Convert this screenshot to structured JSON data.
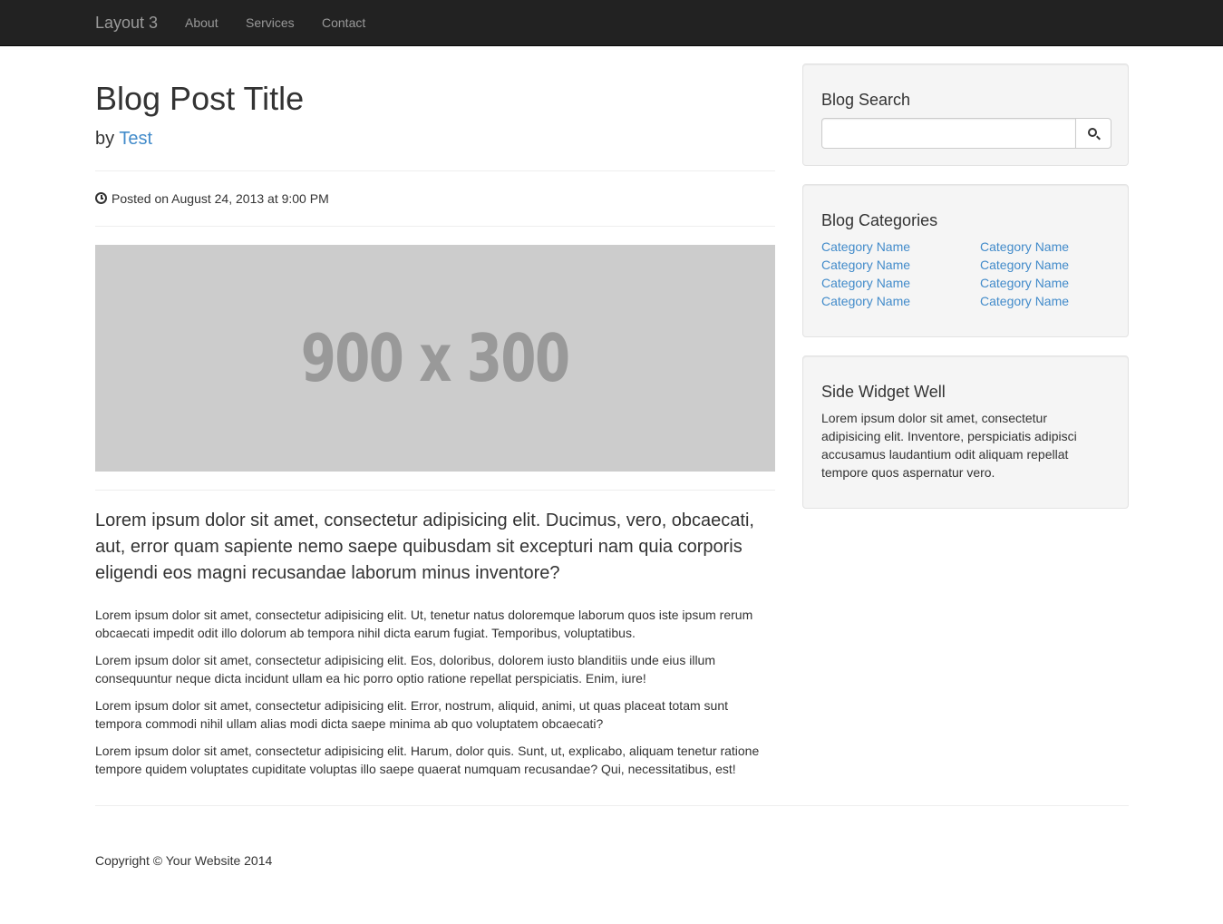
{
  "navbar": {
    "brand": "Layout 3",
    "links": [
      "About",
      "Services",
      "Contact"
    ]
  },
  "post": {
    "title": "Blog Post Title",
    "by_prefix": "by",
    "author": "Test",
    "posted_on": "Posted on August 24, 2013 at 9:00 PM",
    "image_placeholder": "900 x 300",
    "lead": "Lorem ipsum dolor sit amet, consectetur adipisicing elit. Ducimus, vero, obcaecati, aut, error quam sapiente nemo saepe quibusdam sit excepturi nam quia corporis eligendi eos magni recusandae laborum minus inventore?",
    "paragraphs": [
      "Lorem ipsum dolor sit amet, consectetur adipisicing elit. Ut, tenetur natus doloremque laborum quos iste ipsum rerum obcaecati impedit odit illo dolorum ab tempora nihil dicta earum fugiat. Temporibus, voluptatibus.",
      "Lorem ipsum dolor sit amet, consectetur adipisicing elit. Eos, doloribus, dolorem iusto blanditiis unde eius illum consequuntur neque dicta incidunt ullam ea hic porro optio ratione repellat perspiciatis. Enim, iure!",
      "Lorem ipsum dolor sit amet, consectetur adipisicing elit. Error, nostrum, aliquid, animi, ut quas placeat totam sunt tempora commodi nihil ullam alias modi dicta saepe minima ab quo voluptatem obcaecati?",
      "Lorem ipsum dolor sit amet, consectetur adipisicing elit. Harum, dolor quis. Sunt, ut, explicabo, aliquam tenetur ratione tempore quidem voluptates cupiditate voluptas illo saepe quaerat numquam recusandae? Qui, necessitatibus, est!"
    ]
  },
  "sidebar": {
    "search": {
      "title": "Blog Search",
      "value": "",
      "icon": "search-icon"
    },
    "categories": {
      "title": "Blog Categories",
      "left": [
        "Category Name",
        "Category Name",
        "Category Name",
        "Category Name"
      ],
      "right": [
        "Category Name",
        "Category Name",
        "Category Name",
        "Category Name"
      ]
    },
    "widget": {
      "title": "Side Widget Well",
      "text": "Lorem ipsum dolor sit amet, consectetur adipisicing elit. Inventore, perspiciatis adipisci accusamus laudantium odit aliquam repellat tempore quos aspernatur vero."
    }
  },
  "footer": {
    "copyright": "Copyright © Your Website 2014"
  },
  "colors": {
    "navbar_bg": "#222222",
    "link": "#428bca",
    "well_bg": "#f5f5f5",
    "placeholder_bg": "#cccccc"
  }
}
